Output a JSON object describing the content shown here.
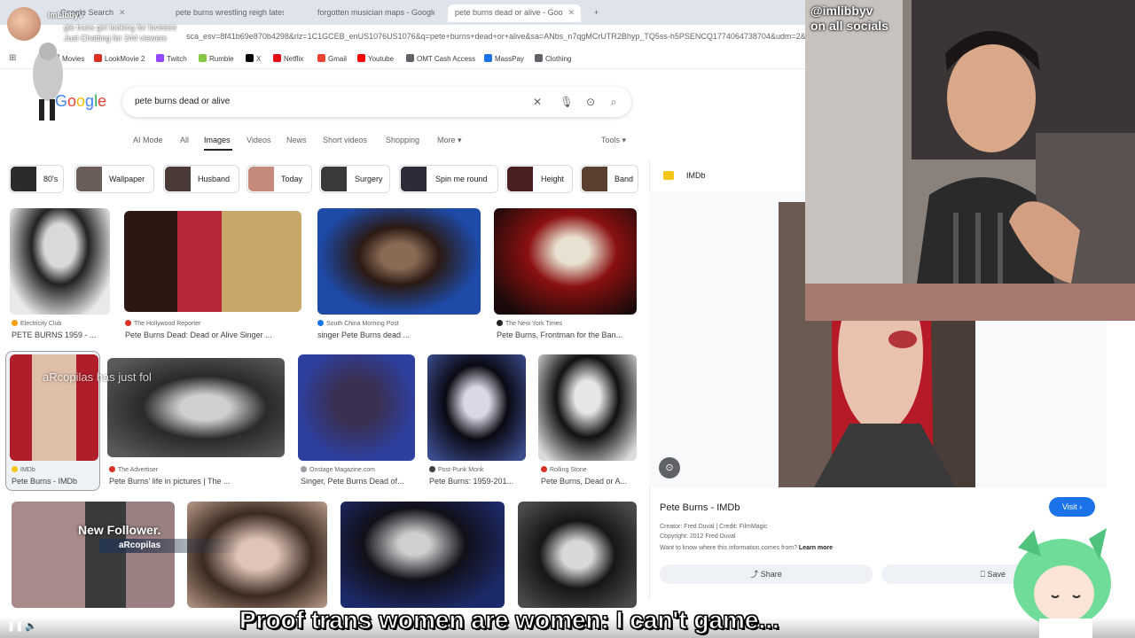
{
  "stream": {
    "name": "ImLibbyV",
    "title": "gle trans girl looking for loveeee",
    "status": "Just Chatting for 244 viewers",
    "webcam_handle": "@imlibbyv",
    "webcam_social": "on all socials"
  },
  "browser": {
    "tabs": [
      {
        "label": "Google Search"
      },
      {
        "label": "pete burns wrestling reigh latest"
      },
      {
        "label": "forgotten musician maps - Google"
      },
      {
        "label": "pete burns dead or alive - Goo",
        "active": true
      }
    ],
    "url": "sca_esv=8f41b69e870b4298&rlz=1C1GCEB_enUS1076US1076&q=pete+burns+dead+or+alive&sa=ANbs_n7qgMCrUTR2Bhyp_TQ5ss-h5PSENCQ1774064738704&udm=2&fbs=ADc_l_aN0CWEZBOHjofHoaM",
    "bookmarks": [
      {
        "label": "Movies",
        "color": "#5f6368"
      },
      {
        "label": "LookMovie 2",
        "color": "#d93025"
      },
      {
        "label": "Twitch",
        "color": "#9146ff"
      },
      {
        "label": "Rumble",
        "color": "#85c742"
      },
      {
        "label": "X",
        "color": "#000000"
      },
      {
        "label": "Netflix",
        "color": "#e50914"
      },
      {
        "label": "Gmail",
        "color": "#ea4335"
      },
      {
        "label": "Youtube",
        "color": "#ff0000"
      },
      {
        "label": "OMT Cash Access",
        "color": "#5f6368"
      },
      {
        "label": "MassPay",
        "color": "#1a73e8"
      },
      {
        "label": "Clothing",
        "color": "#5f6368"
      }
    ]
  },
  "google": {
    "logo": [
      "G",
      "o",
      "o",
      "g",
      "l",
      "e"
    ],
    "query": "pete burns dead or alive",
    "tabs": [
      "AI Mode",
      "All",
      "Images",
      "Videos",
      "News",
      "Short videos",
      "Shopping",
      "More"
    ],
    "active_tab": "Images",
    "tools": "Tools",
    "chips": [
      "80's",
      "Wallpaper",
      "Husband",
      "Today",
      "Surgery",
      "Spin me round",
      "Height",
      "Band"
    ]
  },
  "results": [
    {
      "source": "Electricity Club",
      "caption": "PETE BURNS 1959 - ...",
      "fav": "#f59f00"
    },
    {
      "source": "The Hollywood Reporter",
      "caption": "Pete Burns Dead: Dead or Alive Singer ...",
      "fav": "#d93025"
    },
    {
      "source": "South China Morning Post",
      "caption": "singer Pete Burns dead ...",
      "fav": "#1a73e8"
    },
    {
      "source": "The New York Times",
      "caption": "Pete Burns, Frontman for the Ban...",
      "fav": "#202124"
    },
    {
      "source": "IMDb",
      "caption": "Pete Burns - IMDb",
      "fav": "#f5c518"
    },
    {
      "source": "The Advertiser",
      "caption": "Pete Burns' life in pictures | The ...",
      "fav": "#d93025"
    },
    {
      "source": "Onstage Magazine.com",
      "caption": "Singer, Pete Burns Dead of...",
      "fav": "#9aa0a6"
    },
    {
      "source": "Post-Punk Monk",
      "caption": "Pete Burns: 1959-201...",
      "fav": "#3c4043"
    },
    {
      "source": "Rolling Stone",
      "caption": "Pete Burns, Dead or A...",
      "fav": "#d93025"
    }
  ],
  "panel": {
    "site": "IMDb",
    "title": "Pete Burns - IMDb",
    "visit": "Visit",
    "creator": "Creator: Fred Duval | Credit: FilmMagic",
    "copyright": "Copyright: 2012 Fred Duval",
    "learn_prefix": "Want to know where this information comes from?",
    "learn_link": "Learn more",
    "share": "Share",
    "save": "Save"
  },
  "overlay": {
    "follow_text": "aRcopilas has just fol",
    "new_follower_title": "New Follower.",
    "new_follower_name": "aRcopilas",
    "caption": "Proof trans women are women: I can't game..."
  }
}
